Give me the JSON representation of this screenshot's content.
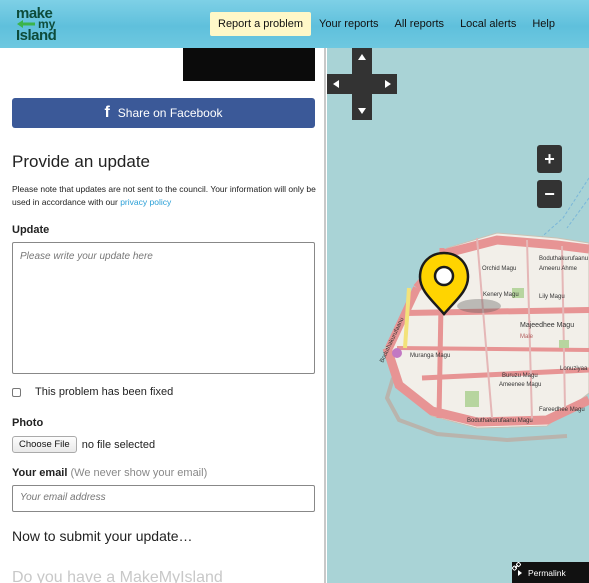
{
  "header": {
    "logo": {
      "line1": "make",
      "line2": "my",
      "line3": "Island"
    },
    "nav": [
      {
        "label": "Report a problem",
        "active": true
      },
      {
        "label": "Your reports",
        "active": false
      },
      {
        "label": "All reports",
        "active": false
      },
      {
        "label": "Local alerts",
        "active": false
      },
      {
        "label": "Help",
        "active": false
      }
    ]
  },
  "panel": {
    "share_label": "Share on Facebook",
    "title": "Provide an update",
    "note_prefix": "Please note that updates are not sent to the council. Your information will only be used in accordance with our ",
    "note_link": "privacy policy",
    "update_label": "Update",
    "update_placeholder": "Please write your update here",
    "fixed_label": "This problem has been fixed",
    "photo_label": "Photo",
    "choose_file": "Choose File",
    "no_file": "no file selected",
    "email_label": "Your email",
    "email_hint": "(We never show your email)",
    "email_placeholder": "Your email address",
    "submit_title": "Now to submit your update…",
    "cut_text": "Do you have a MakeMyIsland"
  },
  "map": {
    "permalink_label": "Permalink",
    "zoom_in": "+",
    "zoom_out": "−",
    "streets": [
      "Boduthakurufaanu Magu",
      "Ameeru Ahmed",
      "Orchid Magu",
      "Kenery Magu",
      "Lily Magu",
      "Majeedhee Magu",
      "Male",
      "Muranga Magu",
      "Buruzu Magu",
      "Ameenee Magu",
      "Fareedhee Magu",
      "Boduthakurufaanu Magu",
      "Lonuziyaa",
      "Boduthakurufaanu Magu"
    ],
    "colors": {
      "water": "#a9d3d6",
      "road": "#e79494",
      "land": "#f2efe9",
      "pin": "#ffd400"
    }
  }
}
